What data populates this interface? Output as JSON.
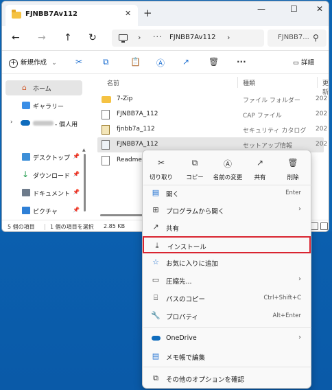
{
  "window": {
    "tab_title": "FJNBB7Av112",
    "tab_close": "✕",
    "new_tab": "+",
    "minimize": "—",
    "maximize": "☐",
    "close": "✕"
  },
  "address": {
    "path": "FJNBB7Av112",
    "more": "···",
    "sep1": "›",
    "sep2": "›",
    "search_placeholder": "FJNBB7..."
  },
  "toolbar": {
    "new_label": "新規作成",
    "new_chevron": "⌄",
    "more": "···",
    "details_label": "詳細"
  },
  "sidebar": {
    "items": [
      {
        "label": "ホーム",
        "icon": "home-icon"
      },
      {
        "label": "ギャラリー",
        "icon": "gallery-icon"
      },
      {
        "label": "- 個人用",
        "icon": "onedrive-icon"
      },
      {
        "label": "デスクトップ",
        "icon": "desktop-icon"
      },
      {
        "label": "ダウンロード",
        "icon": "download-icon"
      },
      {
        "label": "ドキュメント",
        "icon": "document-icon"
      },
      {
        "label": "ピクチャ",
        "icon": "picture-icon"
      }
    ]
  },
  "columns": {
    "name": "名前",
    "type": "種類",
    "date": "更新"
  },
  "files": [
    {
      "name": "7-Zip",
      "type": "ファイル フォルダー",
      "date": "202",
      "icon": "folder-icon"
    },
    {
      "name": "FJNBB7A_112",
      "type": "CAP ファイル",
      "date": "202",
      "icon": "file-icon"
    },
    {
      "name": "fjnbb7a_112",
      "type": "セキュリティ カタログ",
      "date": "202",
      "icon": "catalog-icon"
    },
    {
      "name": "FJNBB7A_112",
      "type": "セットアップ情報",
      "date": "202",
      "icon": "setup-info-icon"
    },
    {
      "name": "Readme",
      "type": "",
      "date": "",
      "icon": "text-file-icon"
    }
  ],
  "status": {
    "count": "5 個の項目",
    "selected": "1 個の項目を選択",
    "size": "2.85 KB"
  },
  "context_menu": {
    "quick_actions": [
      {
        "label": "切り取り",
        "icon": "cut-icon"
      },
      {
        "label": "コピー",
        "icon": "copy-icon"
      },
      {
        "label": "名前の変更",
        "icon": "rename-icon"
      },
      {
        "label": "共有",
        "icon": "share-icon"
      },
      {
        "label": "削除",
        "icon": "delete-icon"
      }
    ],
    "items": [
      {
        "label": "開く",
        "shortcut": "Enter"
      },
      {
        "label": "プログラムから開く",
        "arrow": "›"
      },
      {
        "label": "共有"
      },
      {
        "label": "インストール"
      },
      {
        "label": "お気に入りに追加"
      },
      {
        "label": "圧縮先...",
        "arrow": "›"
      },
      {
        "label": "パスのコピー",
        "shortcut": "Ctrl+Shift+C"
      },
      {
        "label": "プロパティ",
        "shortcut": "Alt+Enter"
      },
      {
        "label": "OneDrive",
        "arrow": "›"
      },
      {
        "label": "メモ帳で編集"
      },
      {
        "label": "その他のオプションを確認"
      }
    ]
  },
  "colors": {
    "accent": "#0067c0",
    "highlight_border": "#d92430",
    "desktop": "#0c64b3"
  }
}
